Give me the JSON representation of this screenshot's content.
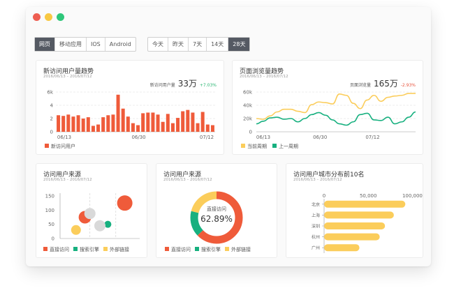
{
  "colors": {
    "orange": "#ef5b3a",
    "green": "#17b07f",
    "yellow": "#fbcd5b",
    "gray": "#d9d9d9",
    "dot_red": "#ee5e52",
    "dot_yellow": "#f8c843",
    "dot_green": "#2fc77a",
    "seg_active": "#555a63"
  },
  "tabs_source": {
    "items": [
      "网页",
      "移动应用",
      "IOS",
      "Android"
    ],
    "active_index": 0
  },
  "tabs_range": {
    "items": [
      "今天",
      "昨天",
      "7天",
      "14天",
      "28天"
    ],
    "active_index": 4
  },
  "card_new_users": {
    "title": "新访问用户量趋势",
    "date": "2016/06/13 – 2016/07/12",
    "metric_label": "新访问用户量",
    "metric_value": "33万",
    "metric_change": "+7.03%"
  },
  "card_pageviews": {
    "title": "页面浏览量趋势",
    "date": "2016/06/13 – 2016/07/12",
    "metric_label": "页面浏览量",
    "metric_value": "165万",
    "metric_change": "-2.93%"
  },
  "card_source_scatter": {
    "title": "访问用户来源",
    "date": "2016/06/13 – 2016/07/12"
  },
  "card_source_donut": {
    "title": "访问用户来源",
    "date": "2016/06/13 – 2016/07/12",
    "center_label": "直接访问",
    "center_value": "62.89%"
  },
  "card_cities": {
    "title": "访问用户城市分布前10名",
    "date": "2016/06/13 – 2016/07/12"
  },
  "legend_source": [
    "直接访问",
    "搜索引擎",
    "外部链接"
  ],
  "chart_data": [
    {
      "type": "bar",
      "x_tick_labels": [
        "06/13",
        "06/30",
        "07/12"
      ],
      "y_tick_labels": [
        "0",
        "2",
        "4",
        "6k"
      ],
      "ylim": [
        0,
        6
      ],
      "grid": true,
      "series": [
        {
          "name": "新访问用户",
          "values": [
            2.5,
            2.4,
            2.6,
            2.3,
            2.5,
            2.0,
            2.2,
            0.9,
            1.1,
            2.2,
            2.5,
            2.6,
            5.6,
            3.5,
            2.3,
            1.3,
            1.0,
            2.8,
            2.9,
            2.9,
            2.6,
            1.5,
            2.7,
            1.3,
            2.1,
            3.1,
            3.3,
            2.9,
            1.3,
            3.0,
            1.1,
            1.0
          ]
        }
      ]
    },
    {
      "type": "line",
      "x_tick_labels": [
        "06/13",
        "06/30",
        "07/12"
      ],
      "y_tick_labels": [
        "0",
        "20k",
        "40k",
        "60k"
      ],
      "ylim": [
        0,
        60
      ],
      "grid": true,
      "series": [
        {
          "name": "当前周期",
          "values": [
            20,
            19,
            24,
            30,
            34,
            34,
            31,
            29,
            41,
            45,
            44,
            42,
            57,
            55,
            43,
            35,
            48,
            55,
            46,
            52,
            54,
            55,
            58,
            58
          ]
        },
        {
          "name": "上一周期",
          "values": [
            12,
            16,
            21,
            22,
            19,
            20,
            15,
            20,
            26,
            29,
            25,
            18,
            12,
            10,
            15,
            26,
            28,
            18,
            17,
            22,
            12,
            15,
            22,
            30
          ]
        }
      ]
    },
    {
      "type": "scatter",
      "y_tick_labels": [
        "0",
        "50",
        "100",
        "150"
      ],
      "ylim": [
        0,
        150
      ],
      "series": [
        {
          "name": "直接访问",
          "points": [
            [
              6.5,
              125,
              11
            ],
            [
              2.5,
              75,
              9
            ]
          ]
        },
        {
          "name": "搜索引擎",
          "points": [
            [
              4.8,
              50,
              5
            ]
          ]
        },
        {
          "name": "外部链接",
          "points": [
            [
              1.6,
              30,
              7
            ]
          ]
        },
        {
          "name": "",
          "points": [
            [
              3.0,
              88,
              8
            ],
            [
              4.0,
              45,
              8
            ]
          ]
        }
      ]
    },
    {
      "type": "pie",
      "categories": [
        "直接访问",
        "搜索引擎",
        "外部链接"
      ],
      "values": [
        62.89,
        16.0,
        21.11
      ]
    },
    {
      "type": "bar",
      "orientation": "horizontal",
      "categories": [
        "北京",
        "上海",
        "深圳",
        "杭州",
        "广州"
      ],
      "values": [
        92000,
        79000,
        69000,
        63000,
        40000
      ],
      "x_tick_labels": [
        "0",
        "50,000",
        "100,000"
      ],
      "xlim": [
        0,
        106000
      ]
    }
  ]
}
